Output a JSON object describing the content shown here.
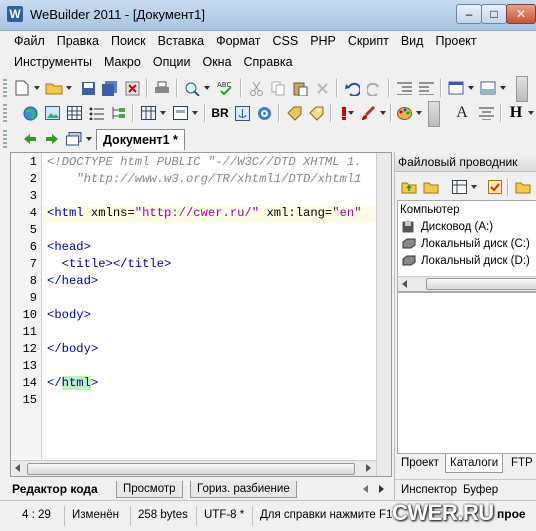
{
  "window": {
    "app_icon_letter": "W",
    "title": "WeBuilder 2011 - [Документ1]",
    "buttons": {
      "minimize": "–",
      "maximize": "□",
      "close": "✕"
    }
  },
  "menu": {
    "row1": [
      "Файл",
      "Правка",
      "Поиск",
      "Вставка",
      "Формат",
      "CSS",
      "PHP",
      "Скрипт",
      "Вид",
      "Проект"
    ],
    "row2": [
      "Инструменты",
      "Макро",
      "Опции",
      "Окна",
      "Справка"
    ]
  },
  "toolbar": {
    "br_label": "BR",
    "text_a_label": "A",
    "heading_label": "H"
  },
  "document_tab": {
    "label": "Документ1 *"
  },
  "editor": {
    "line_numbers": [
      "1",
      "2",
      "3",
      "4",
      "5",
      "6",
      "7",
      "8",
      "9",
      "10",
      "11",
      "12",
      "13",
      "14",
      "15"
    ],
    "lines": {
      "l1": "<!DOCTYPE html PUBLIC \"-//W3C//DTD XHTML 1.",
      "l2": "    \"http://www.w3.org/TR/xhtml1/DTD/xhtml1",
      "l4_open": "<html",
      "l4_attr1": " xmlns=",
      "l4_val1": "\"http://cwer.ru/\"",
      "l4_attr2": " xml:lang=",
      "l4_val2": "\"en\"",
      "l6": "<head>",
      "l7": "  <title></title>",
      "l8": "</head>",
      "l10": "<body>",
      "l12": "</body>",
      "l14_open": "</",
      "l14_hl": "html",
      "l14_close": ">"
    }
  },
  "editor_tabs": [
    "Редактор кода",
    "Просмотр",
    "Гориз. разбиение"
  ],
  "right_panel": {
    "title": "Файловый проводник",
    "tree": [
      "Компьютер",
      "Дисковод (A:)",
      "Локальный диск (C:)",
      "Локальный диск (D:)"
    ],
    "tabs": [
      "Проект",
      "Каталоги",
      "FTP"
    ],
    "tabs2": [
      "Инспектор",
      "Буфер обмен"
    ]
  },
  "status": {
    "position": "4 : 29",
    "modified": "Изменён",
    "size": "258 bytes",
    "encoding": "UTF-8 *",
    "help": "Для справки нажмите F1",
    "watermark": "CWER.RU",
    "tail": "прое"
  },
  "colors": {
    "tag": "#0000a0",
    "value": "#a000a0",
    "comment": "#888888",
    "match_highlight": "#b9f5b9"
  }
}
